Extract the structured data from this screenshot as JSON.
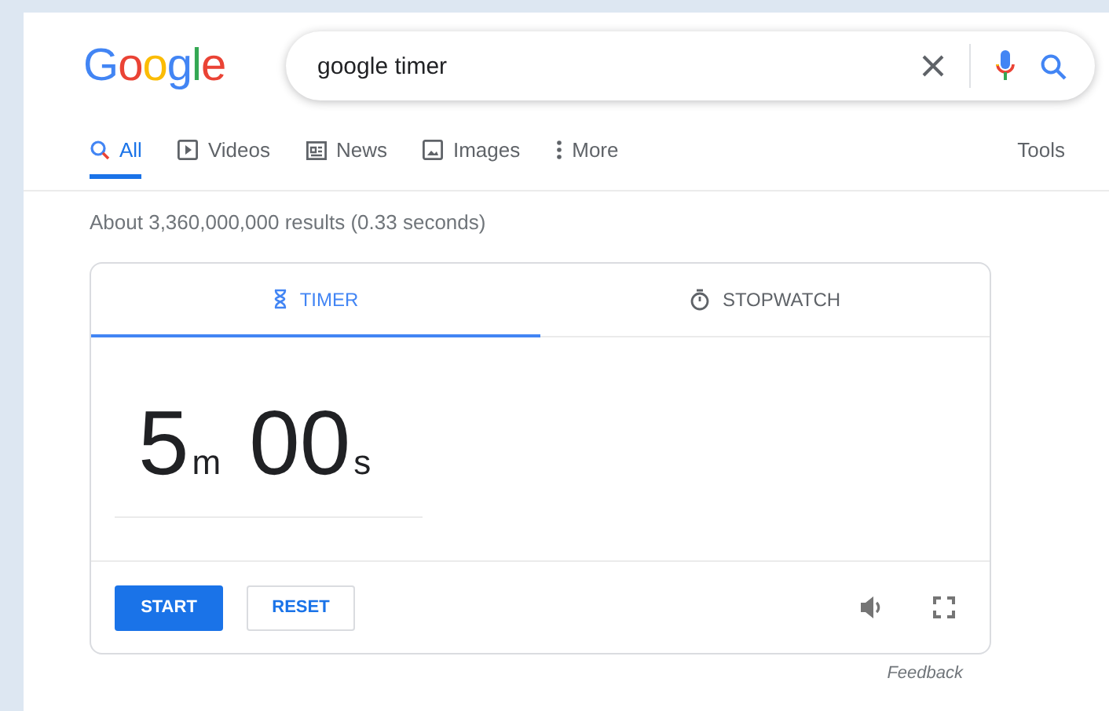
{
  "logo": {
    "letters": [
      {
        "char": "G",
        "color": "#4285f4"
      },
      {
        "char": "o",
        "color": "#ea4335"
      },
      {
        "char": "o",
        "color": "#fbbc05"
      },
      {
        "char": "g",
        "color": "#4285f4"
      },
      {
        "char": "l",
        "color": "#34a853"
      },
      {
        "char": "e",
        "color": "#ea4335"
      }
    ]
  },
  "search": {
    "value": "google timer"
  },
  "nav_tabs": [
    {
      "label": "All",
      "selected": true
    },
    {
      "label": "Videos",
      "selected": false
    },
    {
      "label": "News",
      "selected": false
    },
    {
      "label": "Images",
      "selected": false
    },
    {
      "label": "More",
      "selected": false
    }
  ],
  "tools": "Tools",
  "result_stats": "About 3,360,000,000 results (0.33 seconds)",
  "timer_card": {
    "tabs": [
      {
        "label": "TIMER",
        "selected": true
      },
      {
        "label": "STOPWATCH",
        "selected": false
      }
    ],
    "minutes": "5",
    "minutes_unit": "m",
    "seconds": "00",
    "seconds_unit": "s",
    "buttons": [
      {
        "label": "START",
        "kind": "primary"
      },
      {
        "label": "RESET",
        "kind": "secondary"
      }
    ]
  },
  "feedback": "Feedback"
}
